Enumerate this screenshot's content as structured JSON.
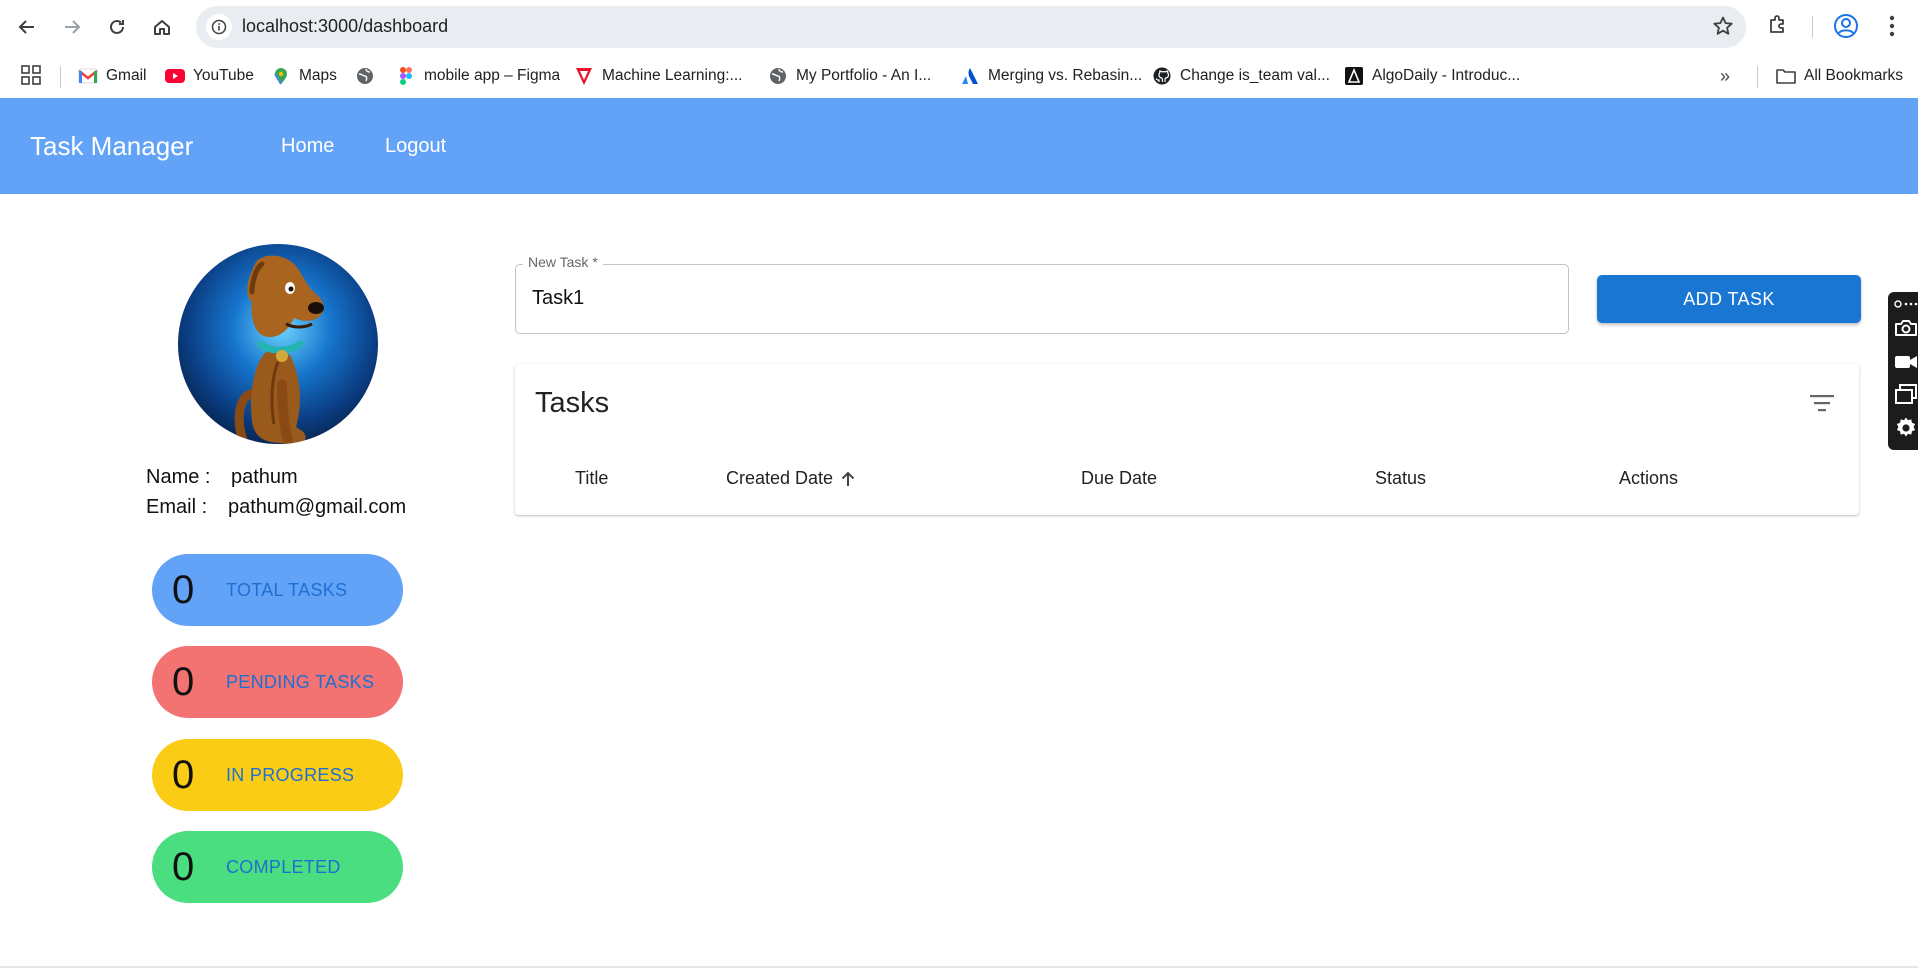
{
  "browser": {
    "url": "localhost:3000/dashboard",
    "bookmarks": [
      {
        "label": "Gmail",
        "icon": "gmail-icon"
      },
      {
        "label": "YouTube",
        "icon": "youtube-icon"
      },
      {
        "label": "Maps",
        "icon": "maps-icon"
      },
      {
        "label": "",
        "icon": "globe-icon"
      },
      {
        "label": "mobile app – Figma",
        "icon": "figma-icon"
      },
      {
        "label": "Machine Learning:...",
        "icon": "udemy-icon"
      },
      {
        "label": "My Portfolio - An I...",
        "icon": "globe-icon"
      },
      {
        "label": "Merging vs. Rebasin...",
        "icon": "atlassian-icon"
      },
      {
        "label": "Change is_team val...",
        "icon": "github-icon"
      },
      {
        "label": "AlgoDaily - Introduc...",
        "icon": "algodaily-icon"
      }
    ],
    "more_bookmarks": "»",
    "all_bookmarks": "All Bookmarks"
  },
  "app": {
    "title": "Task Manager",
    "nav": [
      "Home",
      "Logout"
    ]
  },
  "profile": {
    "name_label": "Name :",
    "name_value": "pathum",
    "email_label": "Email :",
    "email_value": "pathum@gmail.com"
  },
  "stats": [
    {
      "count": "0",
      "label": "TOTAL TASKS",
      "bg": "#62a3f8"
    },
    {
      "count": "0",
      "label": "PENDING TASKS",
      "bg": "#f37373"
    },
    {
      "count": "0",
      "label": "IN PROGRESS",
      "bg": "#facc15"
    },
    {
      "count": "0",
      "label": "COMPLETED",
      "bg": "#4ade80"
    }
  ],
  "task_input": {
    "label": "New Task *",
    "value": "Task1",
    "button": "ADD TASK"
  },
  "tasks_table": {
    "title": "Tasks",
    "columns": [
      "Title",
      "Created Date",
      "Due Date",
      "Status",
      "Actions"
    ],
    "rows": []
  },
  "colors": {
    "appbar": "#62a3f8",
    "primary_button": "#1976d2",
    "stat_label": "#1f6fd1"
  }
}
